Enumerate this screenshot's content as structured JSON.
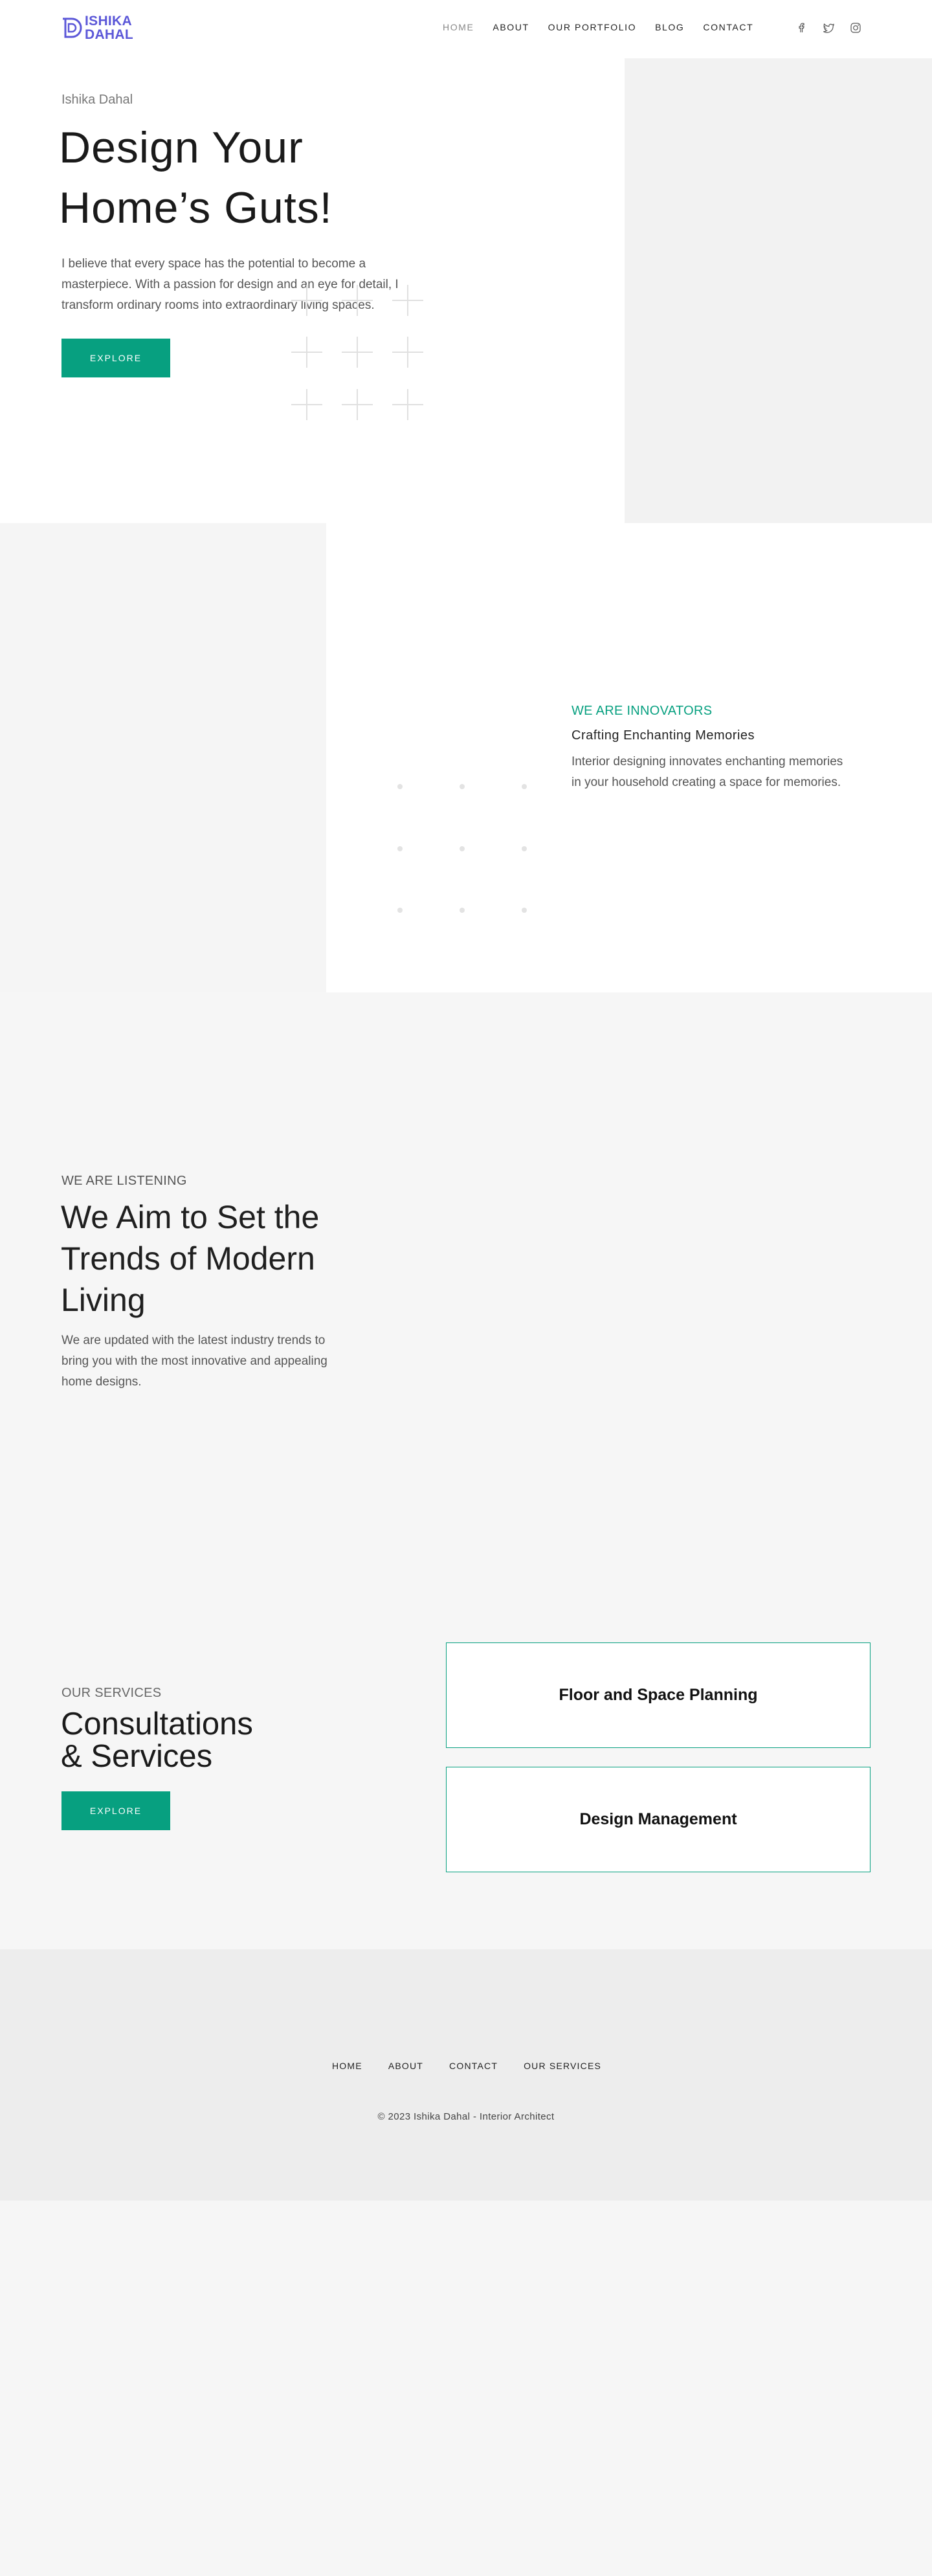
{
  "header": {
    "logo": {
      "line1": "ISHIKA",
      "line2": "DAHAL",
      "color": "#5b57d8"
    },
    "nav": [
      {
        "label": "HOME",
        "active": true
      },
      {
        "label": "ABOUT"
      },
      {
        "label": "OUR PORTFOLIO"
      },
      {
        "label": "BLOG"
      },
      {
        "label": "CONTACT"
      }
    ],
    "socials": [
      "facebook-icon",
      "twitter-icon",
      "instagram-icon"
    ]
  },
  "hero": {
    "eyebrow": "Ishika Dahal",
    "title": "Design Your Home’s Guts!",
    "description": "I believe that every space has the potential to become a masterpiece. With a passion for design and an eye for detail, I transform ordinary rooms into extraordinary living spaces.",
    "button": "EXPLORE"
  },
  "innovators": {
    "eyebrow": "WE ARE INNOVATORS",
    "title": "Crafting Enchanting Memories",
    "description": "Interior designing innovates enchanting memories in your household creating a space for memories."
  },
  "listening": {
    "eyebrow": "WE ARE LISTENING",
    "title": "We Aim to Set the Trends of Modern Living",
    "description": "We are updated with the latest industry trends to bring you with the most innovative and appealing home designs."
  },
  "services": {
    "eyebrow": "OUR SERVICES",
    "title_line1": "Consultations",
    "title_line2": "& Services",
    "button": "EXPLORE",
    "items": [
      "Floor and Space Planning",
      "Design Management"
    ]
  },
  "footer": {
    "nav": [
      "HOME",
      "ABOUT",
      "CONTACT",
      "OUR SERVICES"
    ],
    "copyright": "© 2023 Ishika Dahal - Interior Architect"
  },
  "colors": {
    "accent": "#07a080",
    "brand": "#5b57d8"
  }
}
